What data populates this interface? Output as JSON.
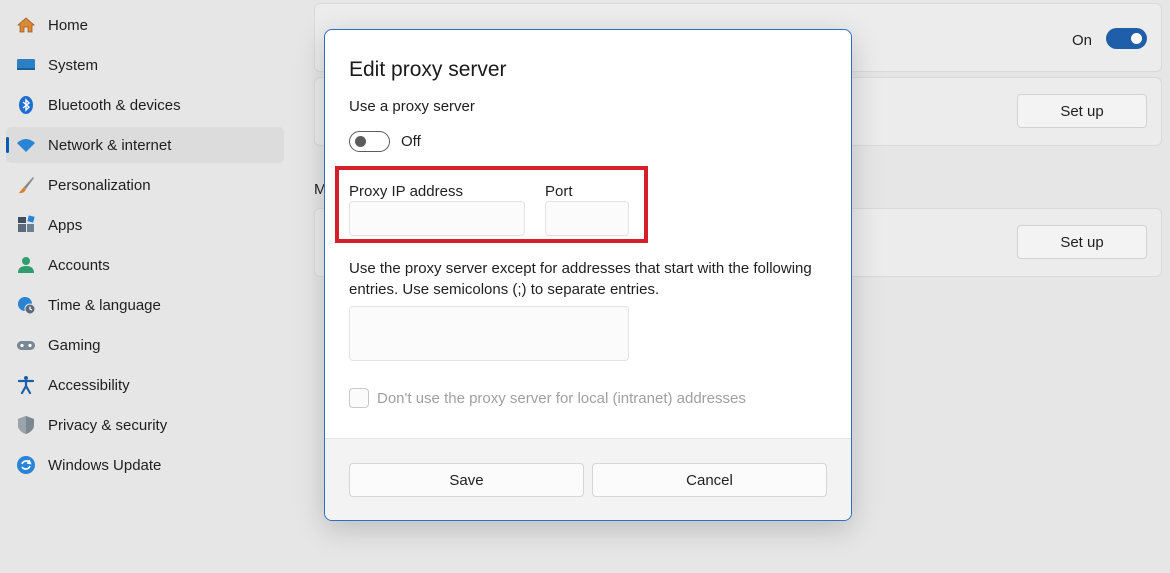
{
  "sidebar": {
    "items": [
      {
        "label": "Home",
        "icon": "home-icon"
      },
      {
        "label": "System",
        "icon": "monitor-icon"
      },
      {
        "label": "Bluetooth & devices",
        "icon": "bluetooth-icon"
      },
      {
        "label": "Network & internet",
        "icon": "wifi-icon",
        "active": true
      },
      {
        "label": "Personalization",
        "icon": "brush-icon"
      },
      {
        "label": "Apps",
        "icon": "apps-icon"
      },
      {
        "label": "Accounts",
        "icon": "person-icon"
      },
      {
        "label": "Time & language",
        "icon": "globe-clock-icon"
      },
      {
        "label": "Gaming",
        "icon": "gamepad-icon"
      },
      {
        "label": "Accessibility",
        "icon": "accessibility-icon"
      },
      {
        "label": "Privacy & security",
        "icon": "shield-icon"
      },
      {
        "label": "Windows Update",
        "icon": "refresh-icon"
      }
    ]
  },
  "background": {
    "toggle_state": "On",
    "setup_button_1": "Set up",
    "setup_button_2": "Set up",
    "section_letter": "M"
  },
  "dialog": {
    "title": "Edit proxy server",
    "use_proxy_label": "Use a proxy server",
    "use_proxy_state": "Off",
    "use_proxy_on": false,
    "proxy_ip_label": "Proxy IP address",
    "proxy_ip_value": "",
    "port_label": "Port",
    "port_value": "",
    "exceptions_description": "Use the proxy server except for addresses that start with the following entries. Use semicolons (;) to separate entries.",
    "exceptions_value": "",
    "local_bypass_label": "Don't use the proxy server for local (intranet) addresses",
    "local_bypass_checked": false,
    "save_label": "Save",
    "cancel_label": "Cancel"
  },
  "colors": {
    "accent": "#1f5ea8",
    "highlight": "#d4202a",
    "dialog_border": "#2f6ec2"
  }
}
